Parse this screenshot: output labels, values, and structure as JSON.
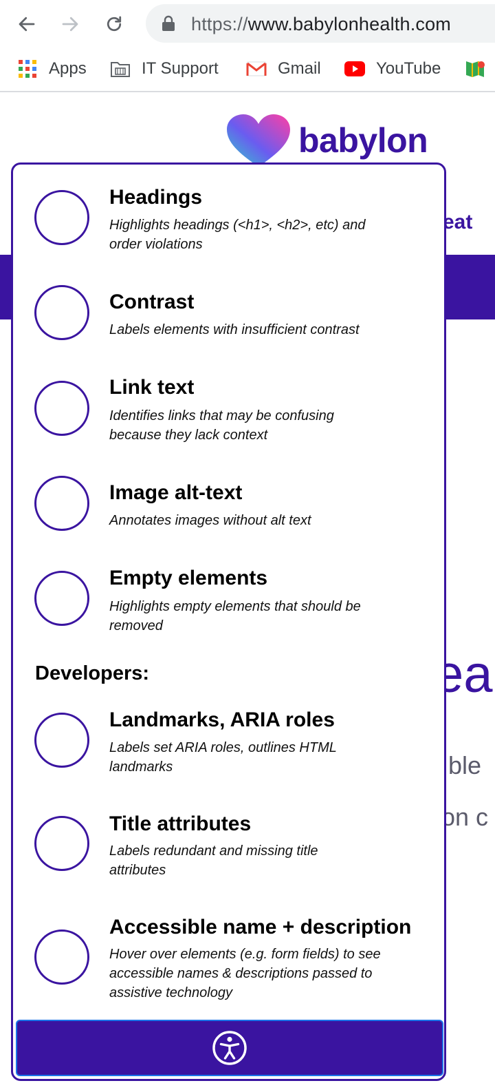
{
  "browser": {
    "url_scheme": "https://",
    "url_host": "www.babylonhealth.com",
    "bookmarks": [
      {
        "label": "Apps",
        "icon": "apps-grid-icon"
      },
      {
        "label": "IT Support",
        "icon": "folder-icon"
      },
      {
        "label": "Gmail",
        "icon": "gmail-icon"
      },
      {
        "label": "YouTube",
        "icon": "youtube-icon"
      }
    ]
  },
  "page": {
    "logo_text": "babylon",
    "fragments": {
      "eat": "eat",
      "ea": "ea",
      "ble": "ble",
      "on": "on c"
    }
  },
  "panel": {
    "items": [
      {
        "title": "Headings",
        "description": "Highlights headings (<h1>, <h2>, etc) and order violations"
      },
      {
        "title": "Contrast",
        "description": "Labels elements with insufficient contrast"
      },
      {
        "title": "Link text",
        "description": "Identifies links that may be confusing because they lack context"
      },
      {
        "title": "Image alt-text",
        "description": "Annotates images without alt text"
      },
      {
        "title": "Empty elements",
        "description": "Highlights empty elements that should be removed"
      }
    ],
    "developers_heading": "Developers:",
    "dev_items": [
      {
        "title": "Landmarks, ARIA roles",
        "description": "Labels set ARIA roles, outlines HTML landmarks"
      },
      {
        "title": "Title attributes",
        "description": "Labels redundant and missing title attributes"
      },
      {
        "title": "Accessible name + description",
        "description": "Hover over elements (e.g. form fields) to see accessible names & descriptions passed to assistive technology"
      }
    ],
    "footer_icon": "accessibility-icon"
  },
  "colors": {
    "brand_purple": "#3a14a0",
    "focus_blue": "#1a73e8"
  }
}
